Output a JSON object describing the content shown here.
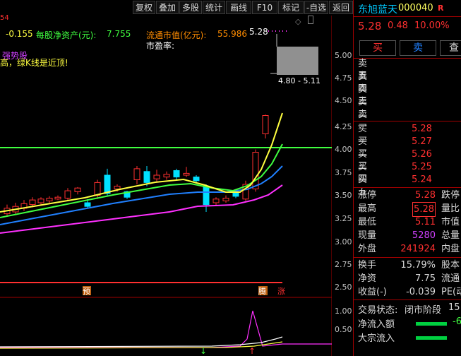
{
  "toolbar": {
    "buttons": [
      "复权",
      "叠加",
      "多股",
      "统计",
      "画线",
      "F10",
      "标记",
      "-自选",
      "返回"
    ]
  },
  "chart": {
    "overlay_icon": "diamond-icon",
    "info": {
      "value_a": "-0.155",
      "nav_label": "每股净资产(元):",
      "nav_value": "7.755",
      "mcap_label": "流通市值(亿元):",
      "mcap_value": "55.986",
      "pe_label": "市盈率:",
      "price_label": "5.28",
      "indicator_name": "强势股",
      "hint": "高，绿K线是近顶!",
      "left_edge": "54"
    },
    "range_box_label": "4.80 - 5.11",
    "price_ticks": [
      "5.00",
      "4.75",
      "4.50",
      "4.25",
      "4.00",
      "3.75",
      "3.50",
      "3.25",
      "3.00",
      "2.75",
      "2.50"
    ],
    "sub_ticks": [
      "1.00",
      "0.50"
    ],
    "markers": {
      "yu": "预",
      "teng": "腾",
      "zhang": "涨"
    },
    "colors": {
      "up": "#ff3030",
      "down": "#00e0ff",
      "ma5": "#ffff40",
      "ma10": "#40ff40",
      "ma20": "#2080ff",
      "ma60": "#ff30ff",
      "hline": "#40ff40"
    }
  },
  "quote": {
    "name": "东旭蓝天",
    "code": "000040",
    "r_mark": "R",
    "price": "5.28",
    "change": "0.48",
    "pct": "10.00%",
    "buy": "买",
    "sell": "卖",
    "query": "查",
    "asks": [
      {
        "label": "卖五",
        "price": ""
      },
      {
        "label": "卖四",
        "price": ""
      },
      {
        "label": "卖三",
        "price": ""
      },
      {
        "label": "卖二",
        "price": ""
      },
      {
        "label": "卖一",
        "price": ""
      }
    ],
    "bids": [
      {
        "label": "买一",
        "price": "5.28"
      },
      {
        "label": "买二",
        "price": "5.27"
      },
      {
        "label": "买三",
        "price": "5.26"
      },
      {
        "label": "买四",
        "price": "5.25"
      },
      {
        "label": "买五",
        "price": "5.24"
      }
    ],
    "stats": [
      {
        "l1": "涨停",
        "v1": "5.28",
        "c1": "#ff3030",
        "l2": "跌停"
      },
      {
        "l1": "最高",
        "v1": "5.28",
        "c1": "#ff3030",
        "l2": "量比"
      },
      {
        "l1": "最低",
        "v1": "5.11",
        "c1": "#ff3030",
        "l2": "市值"
      },
      {
        "l1": "现量",
        "v1": "5280",
        "c1": "#d040ff",
        "l2": "总量"
      },
      {
        "l1": "外盘",
        "v1": "241924",
        "c1": "#ff3030",
        "l2": "内盘"
      },
      {
        "l1": "换手",
        "v1": "15.79%",
        "c1": "#d8d8d8",
        "l2": "股本"
      },
      {
        "l1": "净资",
        "v1": "7.75",
        "c1": "#d8d8d8",
        "l2": "流通"
      },
      {
        "l1": "收益(-)",
        "v1": "-0.039",
        "c1": "#d8d8d8",
        "l2": "PE(动"
      }
    ],
    "trade_status_label": "交易状态:",
    "trade_status_value": "闭市阶段",
    "trade_time": "15:",
    "netflow_label": "净流入额",
    "netflow_value": "-6",
    "bigorder_label": "大宗流入"
  }
}
